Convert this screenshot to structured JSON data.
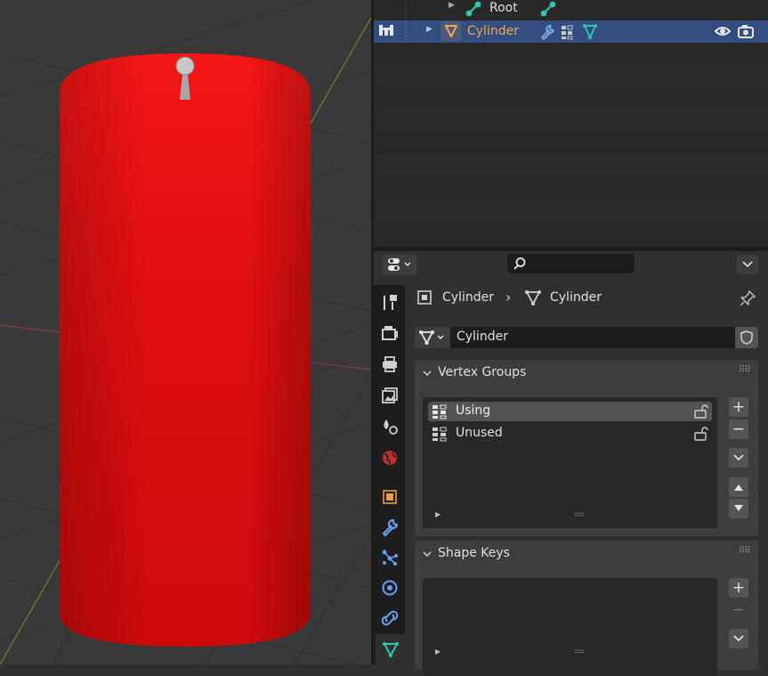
{
  "outliner": {
    "rows": [
      {
        "name": "Root"
      },
      {
        "name": "Cylinder"
      }
    ]
  },
  "breadcrumb": {
    "object": "Cylinder",
    "data": "Cylinder"
  },
  "datablock": {
    "name": "Cylinder"
  },
  "search": {
    "placeholder": ""
  },
  "vertex_groups": {
    "title": "Vertex Groups",
    "items": [
      {
        "label": "Using",
        "selected": true
      },
      {
        "label": "Unused",
        "selected": false
      }
    ]
  },
  "shape_keys": {
    "title": "Shape Keys"
  },
  "colors": {
    "selected_row": "#334d80",
    "object_orange": "#f0a848",
    "mesh_teal": "#2ec4b0",
    "cylinder_red": "#ee1212"
  }
}
